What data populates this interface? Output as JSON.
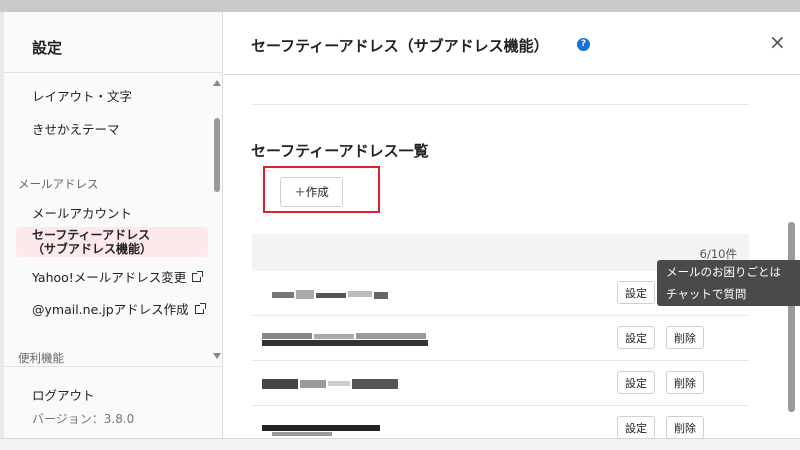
{
  "sidebar": {
    "title": "設定",
    "items_top": [
      {
        "label": "レイアウト・文字"
      },
      {
        "label": "きせかえテーマ"
      }
    ],
    "section_mail": "メールアドレス",
    "items_mail": [
      {
        "label": "メールアカウント"
      },
      {
        "label": "セーフティーアドレス\n（サブアドレス機能）",
        "active": true
      },
      {
        "label": "Yahoo!メールアドレス変更",
        "external": true
      },
      {
        "label": "@ymail.ne.jpアドレス作成",
        "external": true
      }
    ],
    "section_tools": "便利機能",
    "logout": "ログアウト",
    "version": "バージョン：3.8.0"
  },
  "main": {
    "title": "セーフティーアドレス（サブアドレス機能）",
    "help_icon": "?",
    "close_icon": "×",
    "section_title": "セーフティーアドレス一覧",
    "create_label": "＋作成",
    "count": "6/10件",
    "row_buttons": {
      "settings": "設定",
      "delete": "削除"
    },
    "rows": [
      {
        "address": "[redacted]"
      },
      {
        "address": "[redacted]"
      },
      {
        "address": "[redacted]"
      },
      {
        "address": "[redacted]"
      }
    ]
  },
  "tooltip": {
    "line1": "メールのお困りごとは",
    "line2": "チャットで質問"
  },
  "colors": {
    "accent_red": "#e0202a",
    "active_bg": "#fde9ec",
    "help_blue": "#1a6fd8",
    "tooltip_bg": "#4a4a4a"
  }
}
